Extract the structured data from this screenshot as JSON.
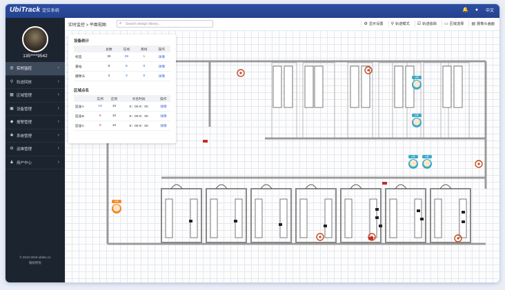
{
  "app": {
    "brand": "UbiTrack",
    "subtitle": "定位系统",
    "language": "中文"
  },
  "user": {
    "phone": "135****9542"
  },
  "sidebar": {
    "items": [
      {
        "label": "实时监控",
        "icon": "location-icon",
        "active": true
      },
      {
        "label": "轨迹回放",
        "icon": "pin-icon"
      },
      {
        "label": "区域管理",
        "icon": "area-icon"
      },
      {
        "label": "设备管理",
        "icon": "device-icon"
      },
      {
        "label": "报警管理",
        "icon": "bell-icon"
      },
      {
        "label": "系统管理",
        "icon": "settings-icon"
      },
      {
        "label": "运维管理",
        "icon": "maintenance-icon"
      },
      {
        "label": "用户中心",
        "icon": "user-icon"
      }
    ],
    "copyright": "© 2013-2019 ubitex.cn",
    "rights": "版权所有"
  },
  "toolbar": {
    "breadcrumb": "实时监控 > 平面视图",
    "search_placeholder": "Search design library...",
    "buttons": [
      {
        "label": "显示设置",
        "icon": "display-icon"
      },
      {
        "label": "轨迹模式",
        "icon": "track-icon"
      },
      {
        "label": "轨迹追踪",
        "icon": "trace-icon"
      },
      {
        "label": "区域选择",
        "icon": "select-area-icon"
      },
      {
        "label": "摄像头画面",
        "icon": "camera-icon"
      }
    ]
  },
  "device_stats": {
    "title": "设备统计",
    "headers": [
      "",
      "总数",
      "在线",
      "离线",
      "操作"
    ],
    "rows": [
      {
        "name": "标签",
        "total": "30",
        "online": "29",
        "offline": "1",
        "action": "详情"
      },
      {
        "name": "基站",
        "total": "8",
        "online": "8",
        "offline": "0",
        "action": "详情"
      },
      {
        "name": "摄像头",
        "total": "3",
        "online": "3",
        "offline": "0",
        "action": "详情"
      }
    ]
  },
  "area_roster": {
    "title": "区域点名",
    "headers": [
      "",
      "实到",
      "应到",
      "点名时段",
      "操作"
    ],
    "rows": [
      {
        "name": "监舍A",
        "actual": "10",
        "expected": "10",
        "period": "8：00-9：00",
        "action": "详情"
      },
      {
        "name": "监舍B",
        "actual": "9",
        "expected": "10",
        "period": "8：00-9：00",
        "action": "详情"
      },
      {
        "name": "监舍C",
        "actual": "9",
        "expected": "10",
        "period": "8：00-9：00",
        "action": "详情"
      }
    ]
  },
  "map": {
    "people": [
      "1号",
      "2号",
      "3号",
      "4号",
      "5号"
    ]
  },
  "colors": {
    "topbar": "#2d4fa1",
    "sidebar": "#1c2430",
    "accent_red": "#d62a2a",
    "accent_blue": "#2a5bd6",
    "tag_orange": "#f08a24",
    "tag_teal": "#3aa8c8"
  }
}
